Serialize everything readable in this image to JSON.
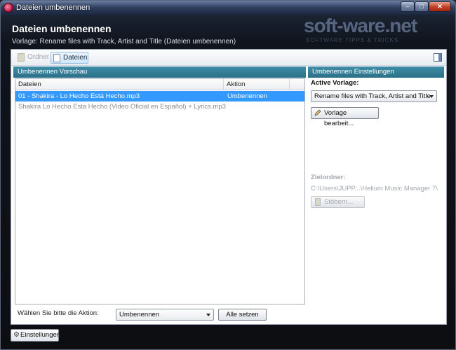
{
  "window": {
    "title": "Dateien umbenennen",
    "controls": {
      "minimize": "–",
      "maximize": "□",
      "close": "✕"
    }
  },
  "header": {
    "title": "Dateien umbenennen",
    "subtitle": "Vorlage: Rename files with Track, Artist and Title (Dateien umbenennen)",
    "watermark": "soft-ware.net",
    "watermark_sub": "SOFTWARE TIPPS & TRICKS"
  },
  "toolbar": {
    "ordner_label": "Ordner",
    "dateien_label": "Dateien"
  },
  "preview": {
    "header": "Umbenennen Vorschau",
    "columns": [
      "Dateien",
      "Aktion",
      ""
    ],
    "rows": [
      {
        "file": "01 - Shakira - Lo Hecho Está Hecho.mp3",
        "action": "Umbenennen",
        "selected": true
      },
      {
        "file": "Shakira Lo Hecho Esta Hecho (Video Oficial en Español) + Lyrics.mp3",
        "action": "",
        "selected": false
      }
    ]
  },
  "action_bar": {
    "label": "Wählen Sie bitte die Aktion:",
    "selected_action": "Umbenennen",
    "apply_label": "Alle setzen"
  },
  "settings": {
    "header": "Umbenennen Einstellungen",
    "active_label": "Active Vorlage:",
    "active_value": "Rename files with Track, Artist and Title",
    "edit_label": "Vorlage bearbeit...",
    "target_label": "Zielordner:",
    "target_path": "C:\\Users\\JUPP...\\Helium Music Manager 7\\",
    "browse_label": "Stöbern..."
  },
  "footer": {
    "settings_label": "Einstellungen"
  },
  "colors": {
    "section_header": "#3f8ea8",
    "selection": "#3399ff"
  }
}
